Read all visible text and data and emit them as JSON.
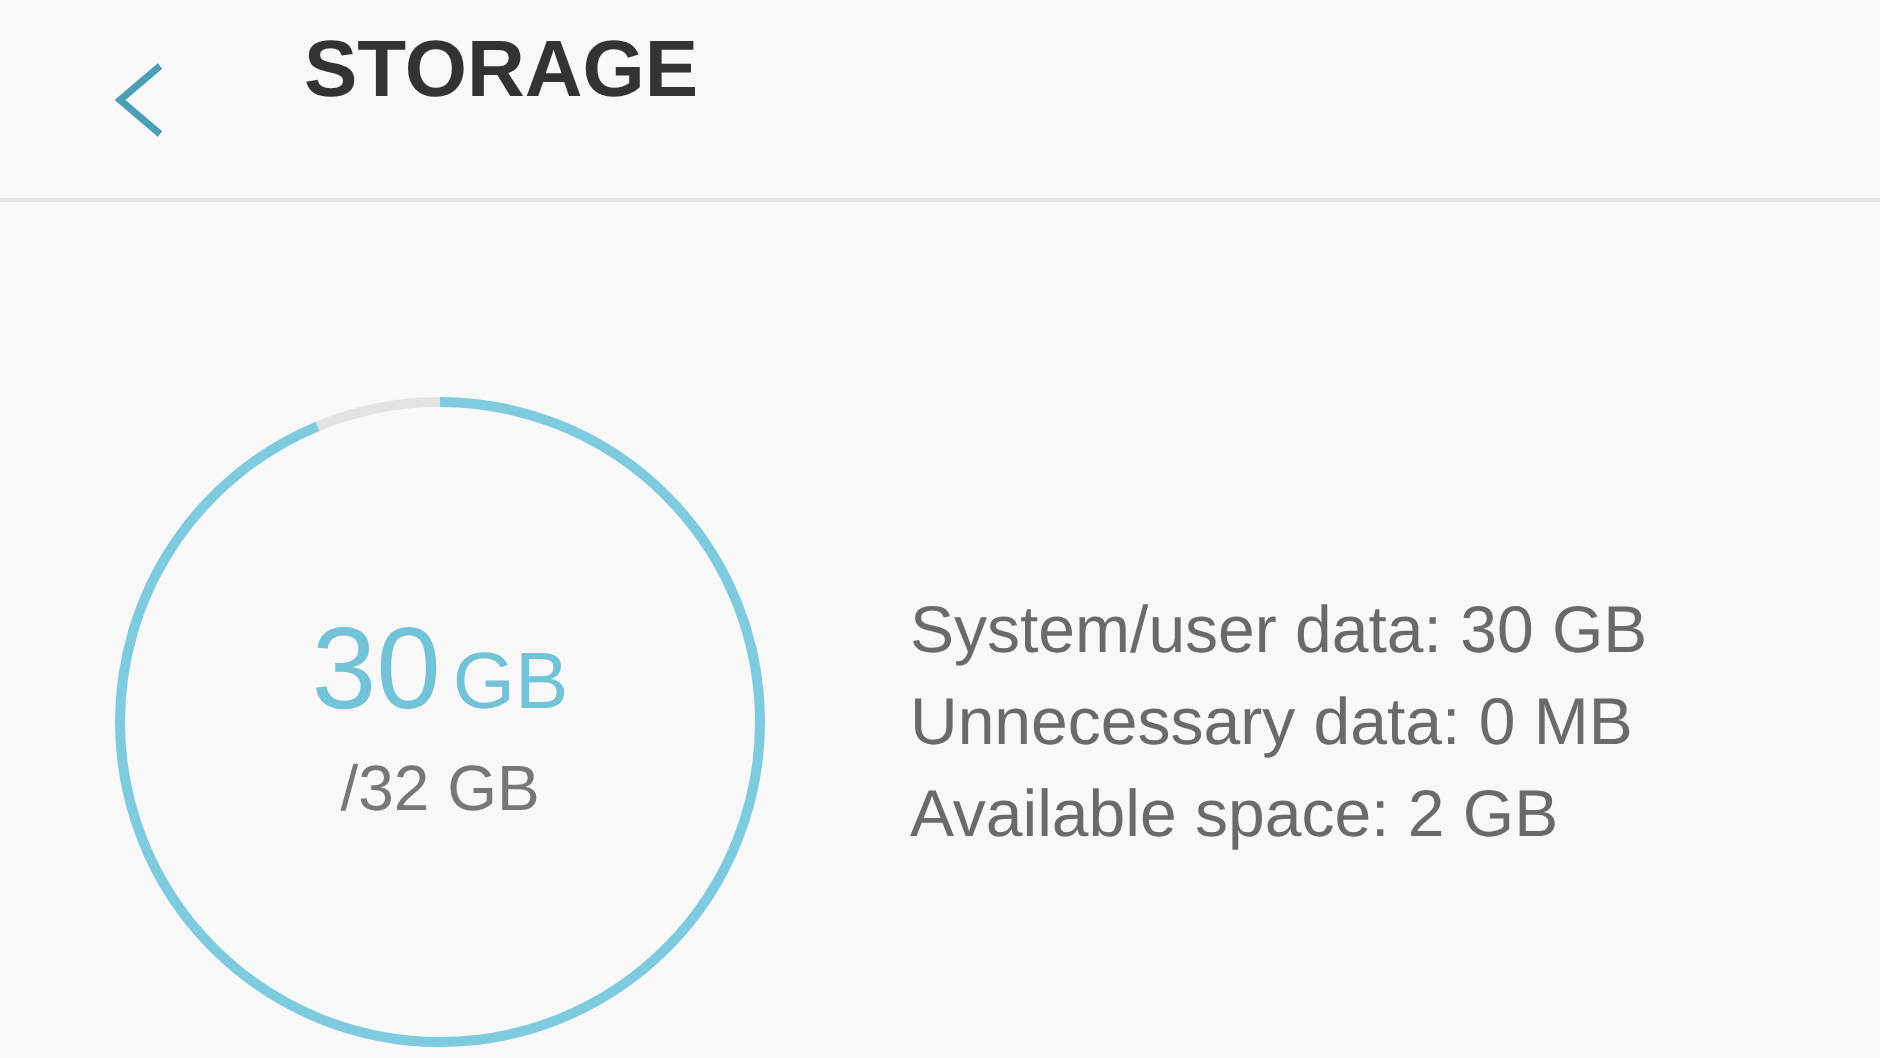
{
  "header": {
    "title": "STORAGE"
  },
  "usage": {
    "used_value": "30",
    "used_unit": "GB",
    "total": "/32 GB",
    "level": 0.9375
  },
  "details": [
    "System/user data: 30 GB",
    "Unnecessary data: 0 MB",
    "Available space: 2 GB"
  ]
}
